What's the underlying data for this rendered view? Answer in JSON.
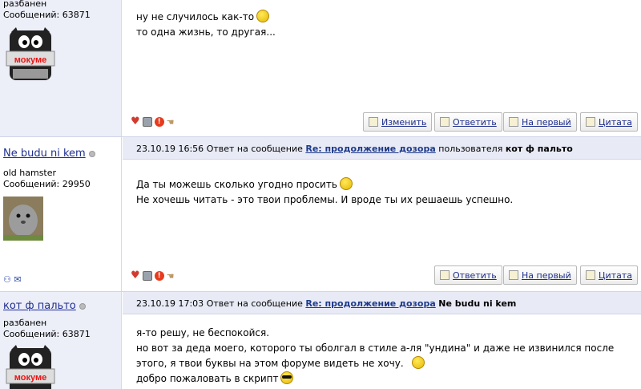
{
  "posts": [
    {
      "username": "",
      "status": "разбанен",
      "count": "Сообщений: 63871",
      "avatar_text": "мокуме",
      "header": null,
      "lines": [
        "ну не случилось как-то",
        "то одна жизнь, то другая..."
      ],
      "buttons": [
        "Изменить",
        "Ответить",
        "На первый",
        "Цитата"
      ]
    },
    {
      "username": "Ne budu ni kem",
      "status": "old hamster",
      "count": "Сообщений: 29950",
      "header": {
        "date": "23.10.19 16:56",
        "prefix": "Ответ на сообщение",
        "link": "Re: продолжение дозора",
        "mid": "пользователя",
        "author": "кот ф пальто"
      },
      "lines": [
        "Да ты можешь сколько угодно просить",
        "Не хочешь читать - это твои проблемы. И вроде ты их решаешь успешно."
      ],
      "buttons": [
        "Ответить",
        "На первый",
        "Цитата"
      ]
    },
    {
      "username": "кот ф пальто",
      "status": "разбанен",
      "count": "Сообщений: 63871",
      "avatar_text": "мокуме",
      "header": {
        "date": "23.10.19 17:03",
        "prefix": "Ответ на сообщение",
        "link": "Re: продолжение дозора",
        "mid": "пользователя",
        "author": "Ne budu ni kem"
      },
      "lines": [
        "я-то решу, не беспокойся.",
        "но вот за деда моего, которого ты оболгал в стиле а-ля \"ундина\" и даже не извинился после",
        "этого, я твои буквы на этом форуме видеть не хочу.",
        "добро пожаловать в скрипт"
      ],
      "buttons": []
    }
  ],
  "colors": {
    "header_bg": "#e8eaf6",
    "sidebar_alt_bg": "#eceef8",
    "link": "#1e3a8a"
  }
}
